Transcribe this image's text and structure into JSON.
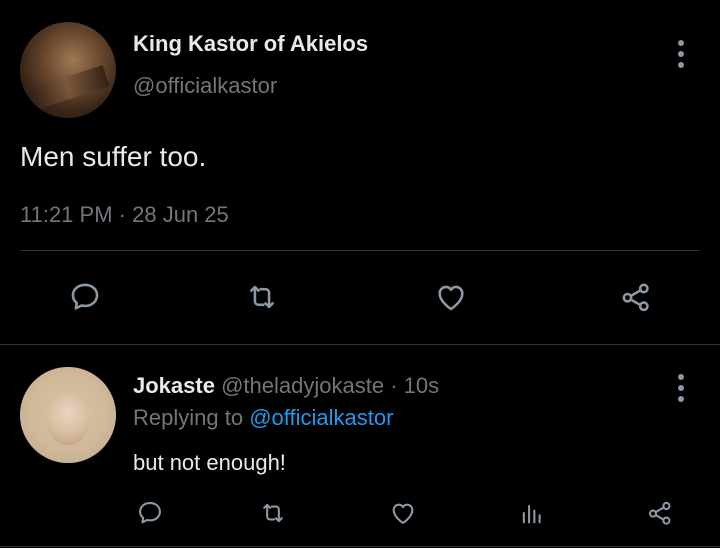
{
  "main_tweet": {
    "author_name": "King Kastor of Akielos",
    "author_handle": "@officialkastor",
    "text": "Men suffer too.",
    "time": "11:21 PM",
    "date": "28 Jun 25",
    "separator": "·"
  },
  "reply": {
    "author_name": "Jokaste",
    "author_handle": "@theladyjokaste",
    "separator": "·",
    "age": "10s",
    "replying_prefix": "Replying to",
    "replying_handle": "@officialkastor",
    "text": "but not enough!"
  },
  "icons": {
    "reply": "comment-icon",
    "retweet": "retweet-icon",
    "like": "heart-icon",
    "views": "views-icon",
    "share": "share-icon",
    "more": "more-options-icon"
  },
  "colors": {
    "background": "#000000",
    "primary_text": "#e7e9ea",
    "secondary_text": "#71767b",
    "link": "#1d9bf0",
    "icon": "#8b98a5",
    "divider": "#2f3336"
  }
}
